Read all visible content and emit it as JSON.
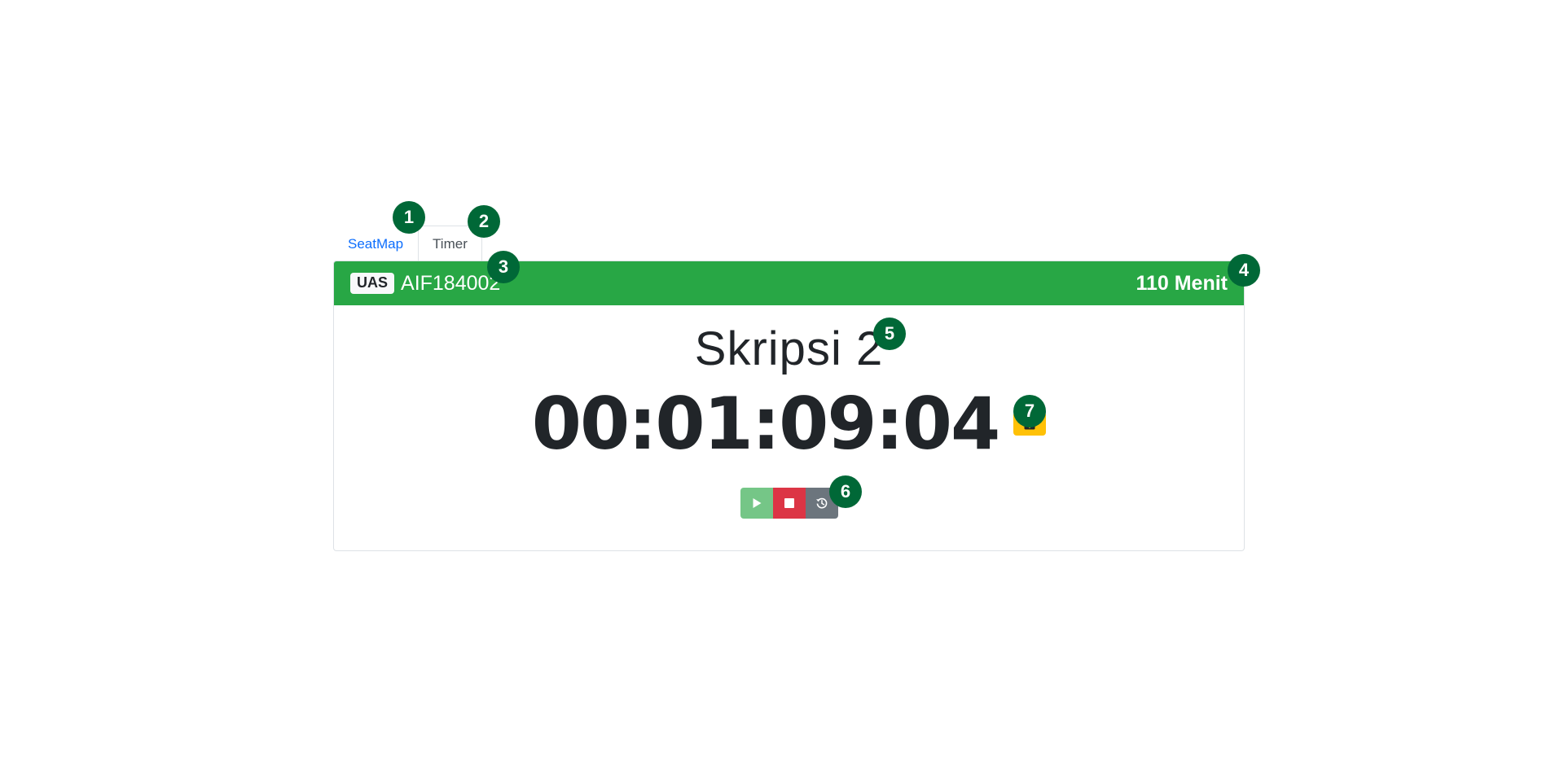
{
  "tabs": [
    {
      "label": "SeatMap",
      "active": false
    },
    {
      "label": "Timer",
      "active": true
    }
  ],
  "exam": {
    "type_badge": "UAS",
    "course_code": "AIF184002",
    "duration": "110 Menit",
    "subject": "Skripsi 2",
    "timer": "00:01:09:04"
  },
  "colors": {
    "header": "#28a745",
    "play": "#75c687",
    "stop": "#dc3545",
    "reset": "#6c757d",
    "add_time": "#ffc107",
    "marker": "#006837"
  },
  "icons": {
    "play": "play-icon",
    "stop": "stop-icon",
    "reset": "history-icon",
    "add_time": "calendar-plus-icon"
  },
  "markers": [
    "1",
    "2",
    "3",
    "4",
    "5",
    "6",
    "7"
  ]
}
